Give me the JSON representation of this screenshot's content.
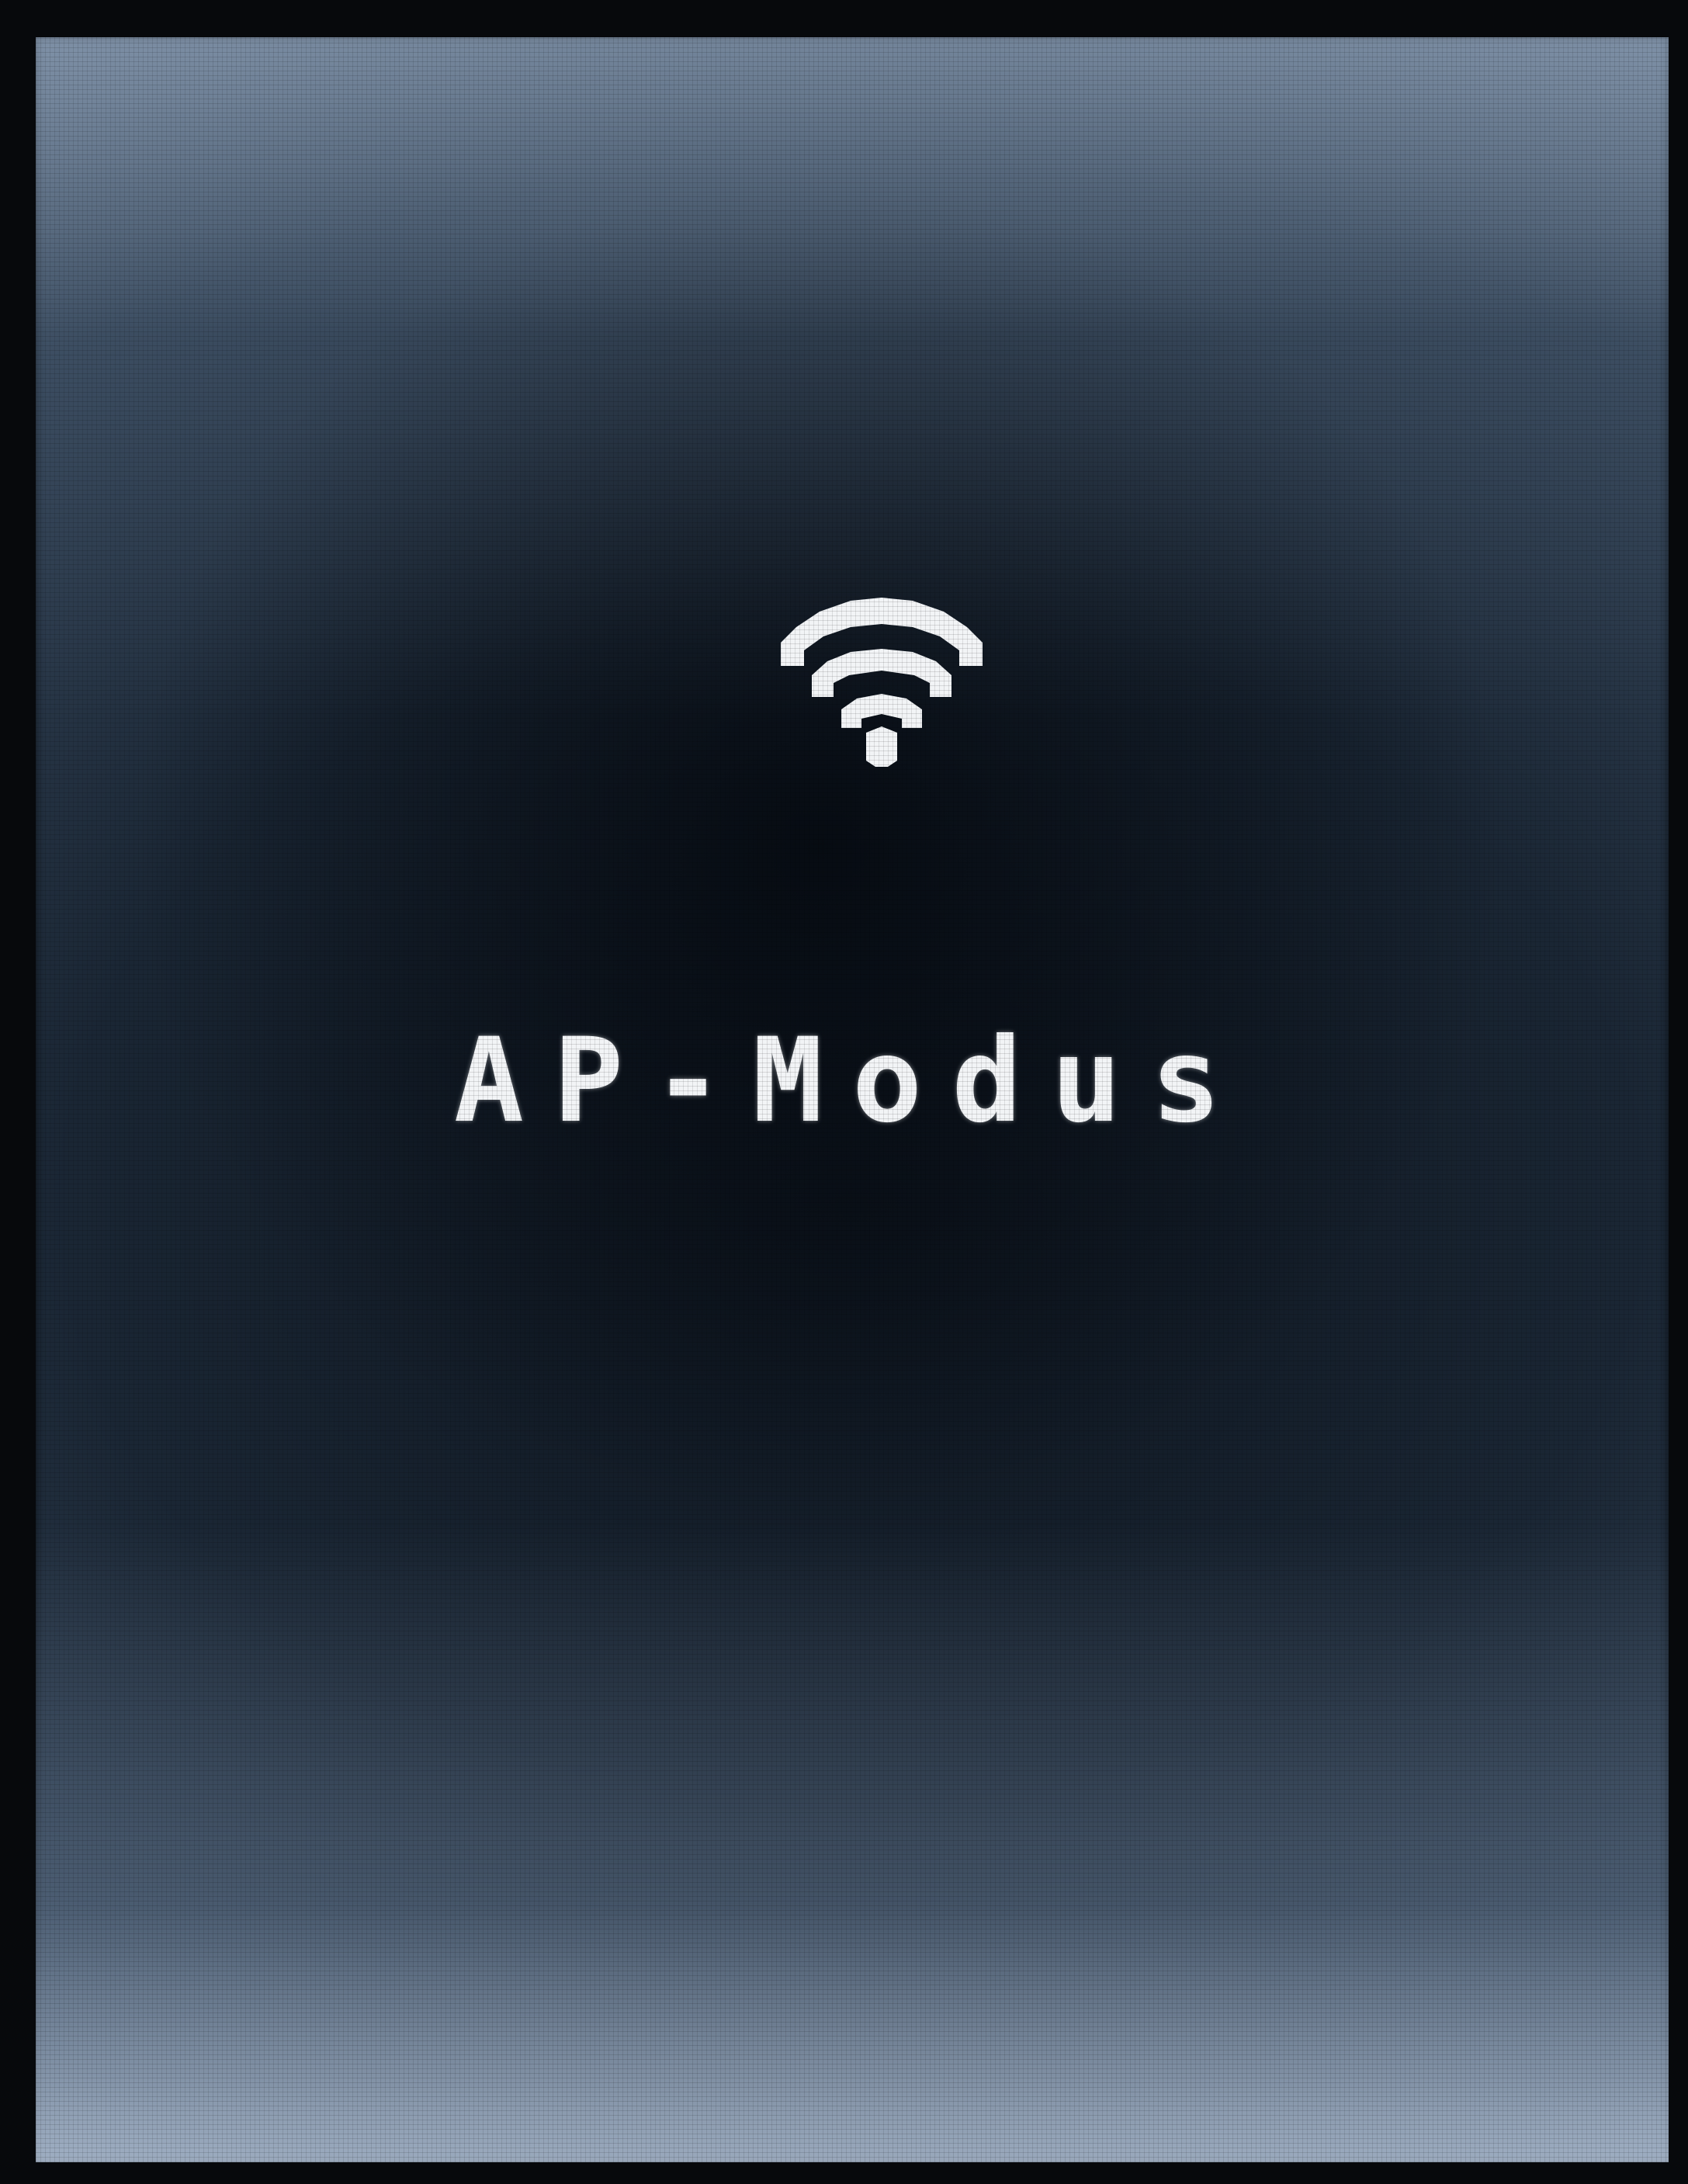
{
  "screen": {
    "icon": "wifi-icon",
    "title": "AP-Modus"
  },
  "colors": {
    "text": "#f2f4f6",
    "background_center": "#0c131c",
    "background_edge": "#7d90a8"
  }
}
